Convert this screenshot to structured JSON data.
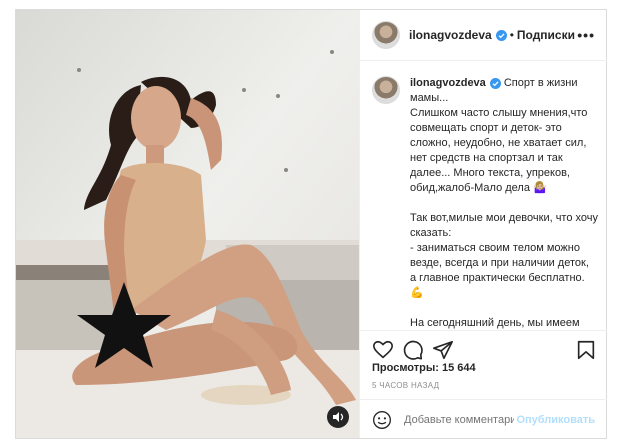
{
  "post": {
    "username": "ilonagvozdeva",
    "follow_label": "Подписки",
    "separator": "•",
    "more_label": "•••",
    "caption_intro": "Спорт в жизни мамы...",
    "caption_body": "Слишком часто слышу мнения,что совмещать спорт и деток- это сложно, неудобно, не хватает сил, нет средств на спортзал и так далее... Много текста, упреков, обид,жалоб-Мало дела 🤷🏼‍♀️\n\nТак вот,милые мои девочки, что хочу сказать:\n- заниматься своим телом можно везде, всегда и при наличии деток, а главное практически бесплатно. 💪\n\nНа сегодняшний день, мы имеем огромный интернет портал и ресурс, чтоб улучшать свою версию \"Я\",",
    "views": "Просмотры: 15 644",
    "time": "5 ЧАСОВ НАЗАД",
    "comment_placeholder": "Добавьте комментарий...",
    "publish_label": "Опубликовать"
  },
  "icons": [
    "verified-icon",
    "heart-icon",
    "comment-icon",
    "share-icon",
    "bookmark-icon",
    "emoji-icon",
    "sound-icon",
    "star-icon"
  ],
  "colors": {
    "verified": "#3897f0",
    "publish_disabled": "#b2dffc",
    "border": "#dbdbdb"
  }
}
